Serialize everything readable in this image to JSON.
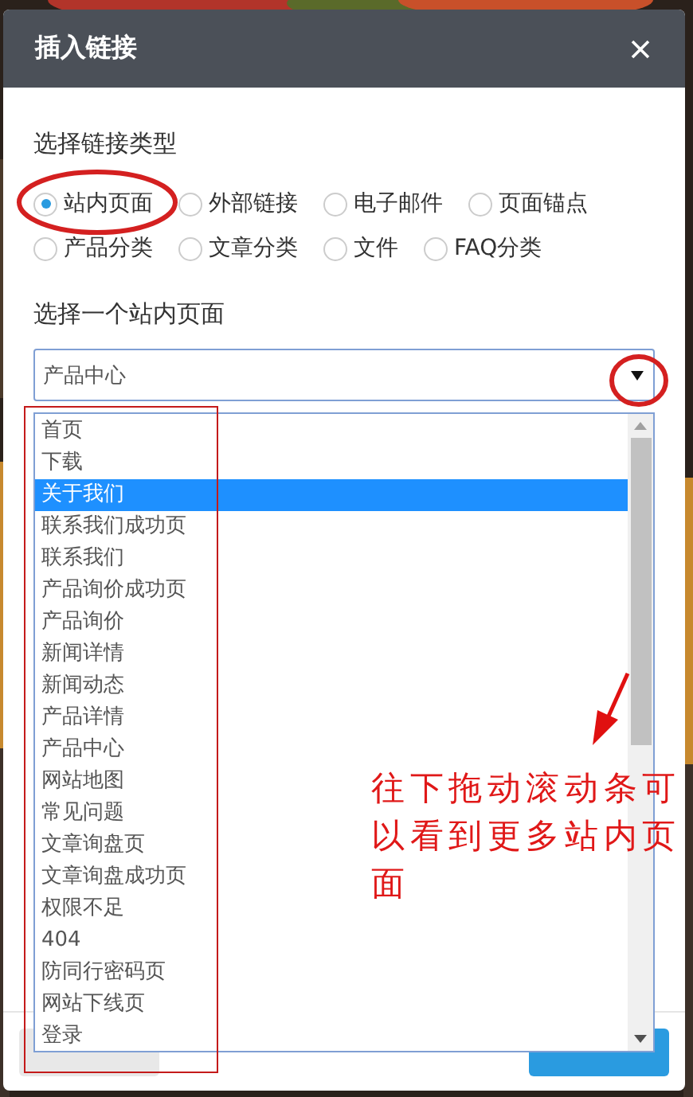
{
  "dialog": {
    "title": "插入链接"
  },
  "link_type": {
    "label": "选择链接类型",
    "options": [
      {
        "label": "站内页面",
        "selected": true
      },
      {
        "label": "外部链接",
        "selected": false
      },
      {
        "label": "电子邮件",
        "selected": false
      },
      {
        "label": "页面锚点",
        "selected": false
      },
      {
        "label": "产品分类",
        "selected": false
      },
      {
        "label": "文章分类",
        "selected": false
      },
      {
        "label": "文件",
        "selected": false
      },
      {
        "label": "FAQ分类",
        "selected": false
      }
    ]
  },
  "page_select": {
    "label": "选择一个站内页面",
    "value": "产品中心",
    "expanded": true,
    "options": [
      {
        "label": "首页",
        "highlighted": false
      },
      {
        "label": "下载",
        "highlighted": false
      },
      {
        "label": "关于我们",
        "highlighted": true
      },
      {
        "label": "联系我们成功页",
        "highlighted": false
      },
      {
        "label": "联系我们",
        "highlighted": false
      },
      {
        "label": "产品询价成功页",
        "highlighted": false
      },
      {
        "label": "产品询价",
        "highlighted": false
      },
      {
        "label": "新闻详情",
        "highlighted": false
      },
      {
        "label": "新闻动态",
        "highlighted": false
      },
      {
        "label": "产品详情",
        "highlighted": false
      },
      {
        "label": "产品中心",
        "highlighted": false
      },
      {
        "label": "网站地图",
        "highlighted": false
      },
      {
        "label": "常见问题",
        "highlighted": false
      },
      {
        "label": "文章询盘页",
        "highlighted": false
      },
      {
        "label": "文章询盘成功页",
        "highlighted": false
      },
      {
        "label": "权限不足",
        "highlighted": false
      },
      {
        "label": "404",
        "highlighted": false
      },
      {
        "label": "防同行密码页",
        "highlighted": false
      },
      {
        "label": "网站下线页",
        "highlighted": false
      },
      {
        "label": "登录",
        "highlighted": false
      }
    ]
  },
  "buttons": [
    {
      "kind": "secondary"
    },
    {
      "kind": "primary"
    }
  ],
  "annotation": {
    "text": "往下拖动滚动条可以看到更多站内页面"
  }
}
